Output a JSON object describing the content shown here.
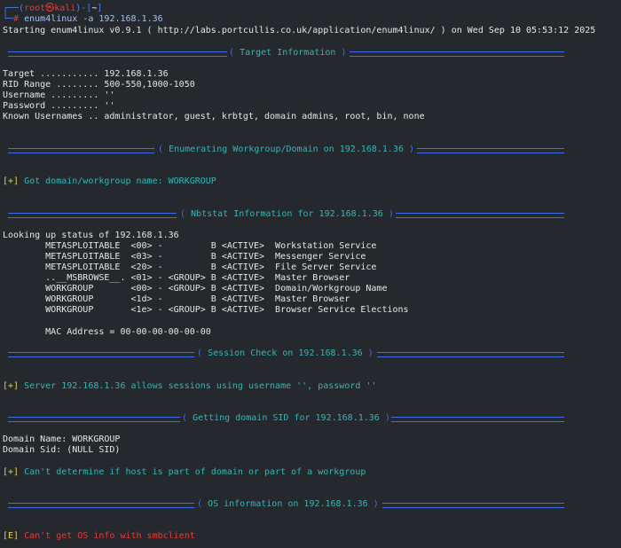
{
  "prompt": {
    "user": "root",
    "host": "kali",
    "symbol": "㉿",
    "path": "~",
    "hash": "#",
    "command": "enum4linux -a 192.168.1.36"
  },
  "starting_line": "Starting enum4linux v0.9.1 ( http://labs.portcullis.co.uk/application/enum4linux/ ) on Wed Sep 10 05:53:12 2025",
  "banners": {
    "target": "Target Information",
    "workgroup": "Enumerating Workgroup/Domain on 192.168.1.36",
    "nbtstat": "Nbtstat Information for 192.168.1.36",
    "session": "Session Check on 192.168.1.36",
    "sid": "Getting domain SID for 192.168.1.36",
    "os": "OS information on 192.168.1.36"
  },
  "target_info": {
    "target": "Target ........... 192.168.1.36",
    "rid": "RID Range ........ 500-550,1000-1050",
    "username": "Username ......... ''",
    "password": "Password ......... ''",
    "known": "Known Usernames .. administrator, guest, krbtgt, domain admins, root, bin, none"
  },
  "workgroup_msg": "[+] Got domain/workgroup name: WORKGROUP",
  "nbtstat": {
    "lookup": "Looking up status of 192.168.1.36",
    "rows": [
      "        METASPLOITABLE  <00> -         B <ACTIVE>  Workstation Service",
      "        METASPLOITABLE  <03> -         B <ACTIVE>  Messenger Service",
      "        METASPLOITABLE  <20> -         B <ACTIVE>  File Server Service",
      "        ..__MSBROWSE__. <01> - <GROUP> B <ACTIVE>  Master Browser",
      "        WORKGROUP       <00> - <GROUP> B <ACTIVE>  Domain/Workgroup Name",
      "        WORKGROUP       <1d> -         B <ACTIVE>  Master Browser",
      "        WORKGROUP       <1e> - <GROUP> B <ACTIVE>  Browser Service Elections"
    ],
    "mac": "        MAC Address = 00-00-00-00-00-00"
  },
  "session_msg": "[+] Server 192.168.1.36 allows sessions using username '', password ''",
  "sid": {
    "domain_name": "Domain Name: WORKGROUP",
    "domain_sid": "Domain Sid: (NULL SID)",
    "msg": "[+] Can't determine if host is part of domain or part of a workgroup"
  },
  "os_msg": "[E] Can't get OS info with smbclient",
  "colors": {
    "background": "#25292e",
    "banner": "#3f6fe6",
    "teal": "#34b5b5",
    "error": "#e23b3b",
    "plus": "#e2d24d"
  }
}
